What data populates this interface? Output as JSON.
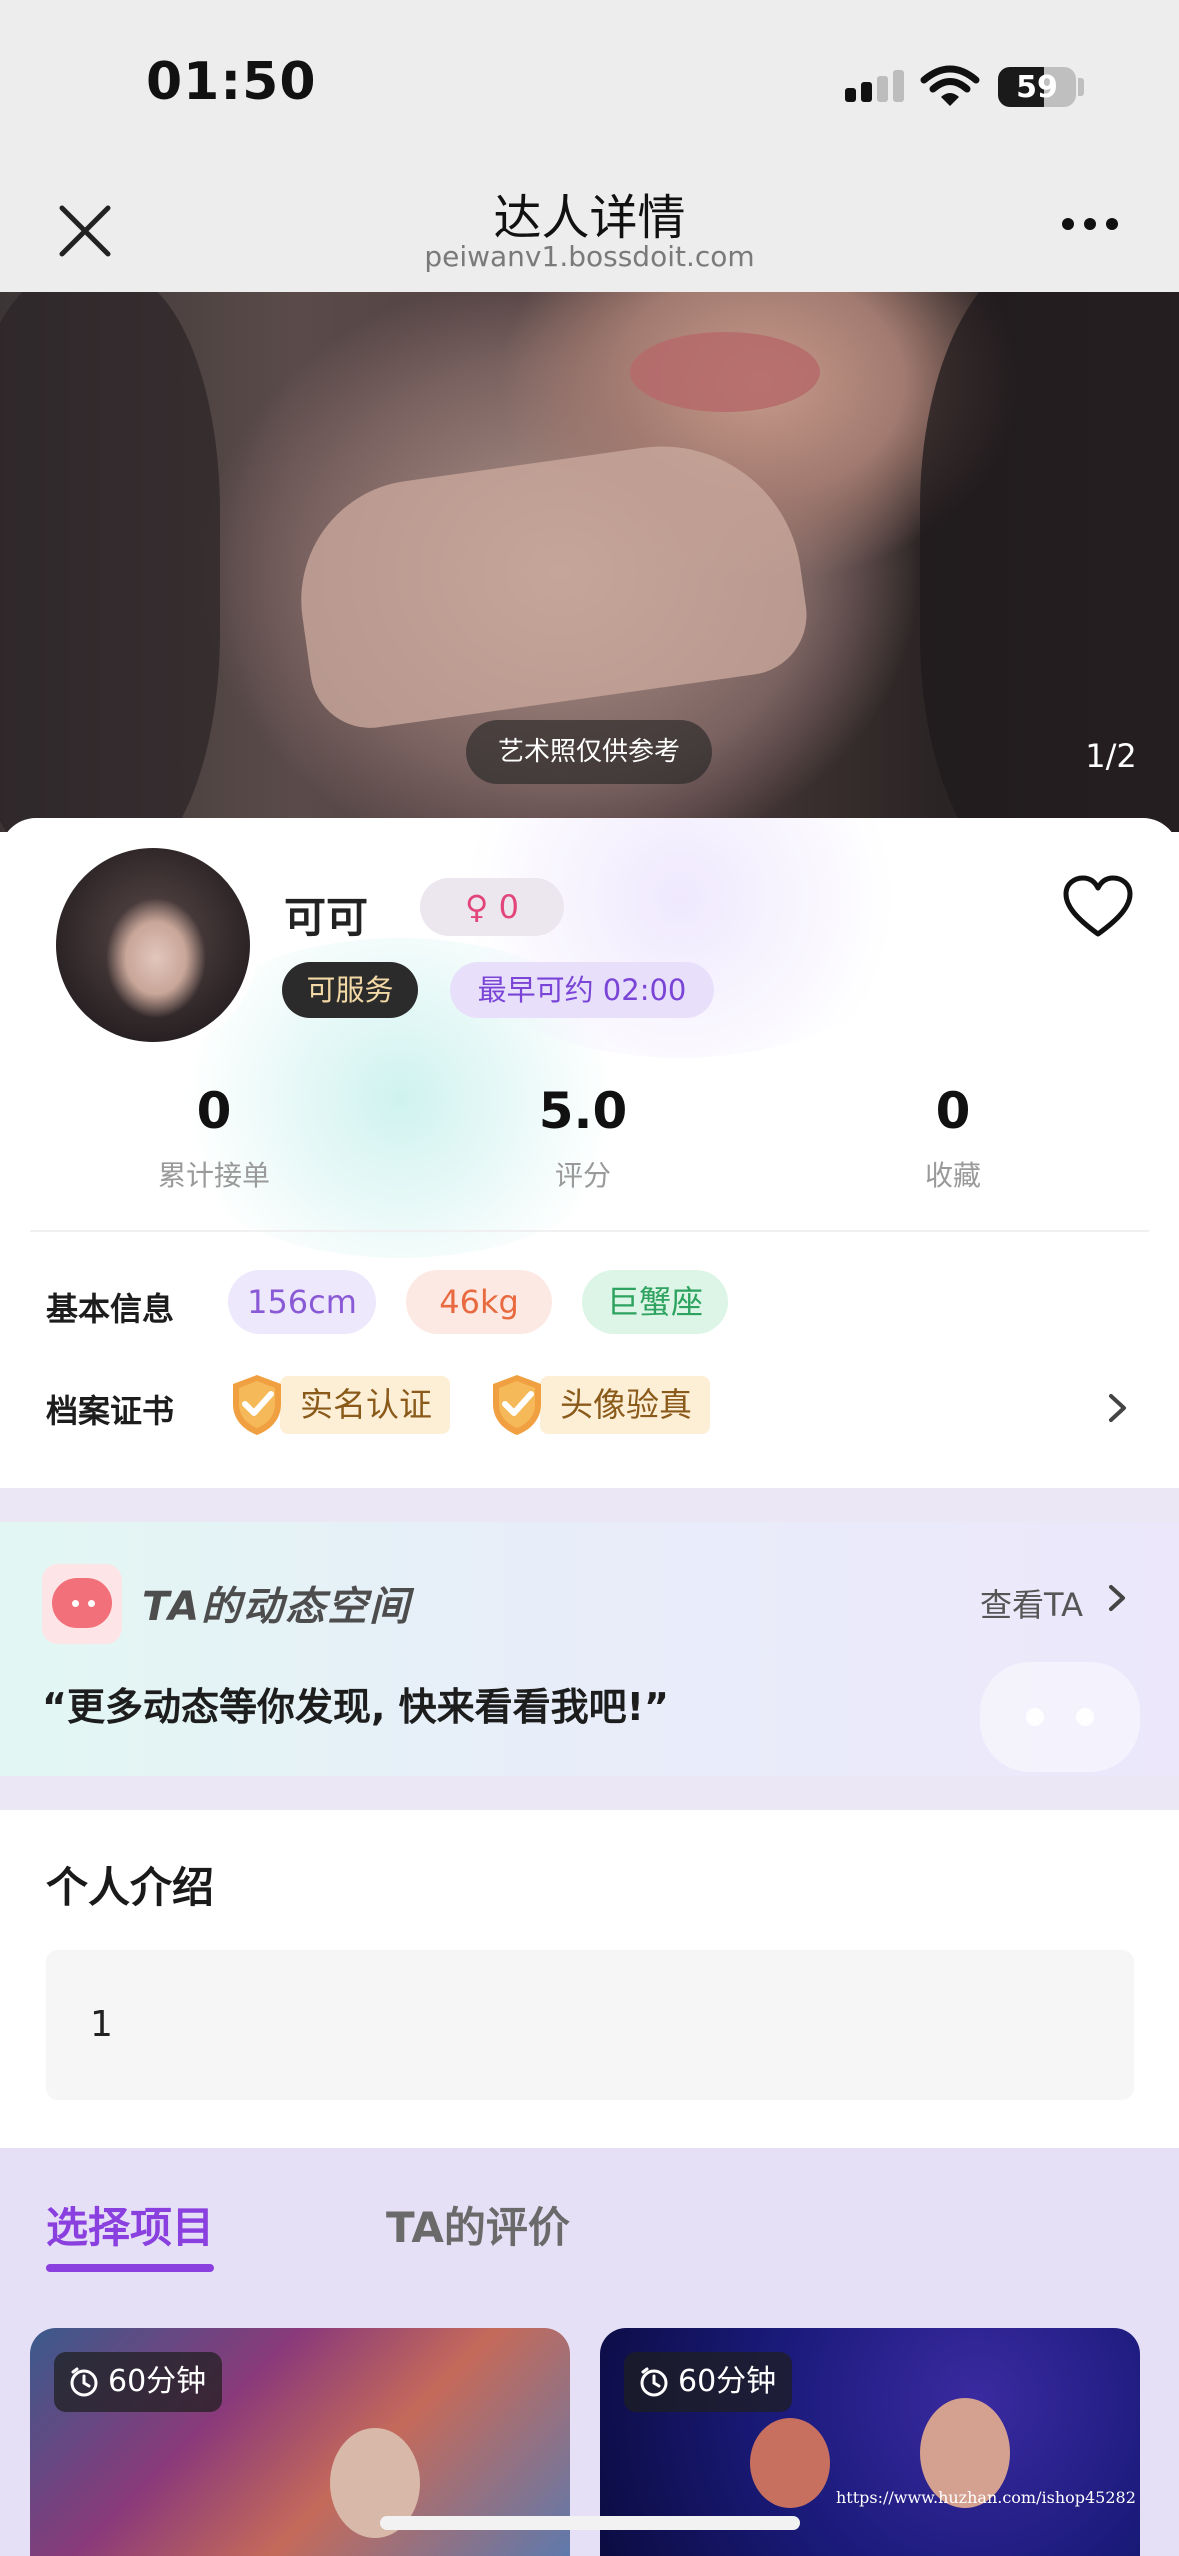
{
  "status_bar": {
    "time": "01:50",
    "battery": "59",
    "battery_fraction": 0.59
  },
  "header": {
    "title": "达人详情",
    "url": "peiwanv1.bossdoit.com"
  },
  "hero": {
    "art_notice": "艺术照仅供参考",
    "counter": "1/2"
  },
  "profile": {
    "name": "可可",
    "gender_symbol": "♀",
    "gender_count": "0",
    "status": "可服务",
    "earliest": "最早可约 02:00",
    "stats": [
      {
        "value": "0",
        "label": "累计接单"
      },
      {
        "value": "5.0",
        "label": "评分"
      },
      {
        "value": "0",
        "label": "收藏"
      }
    ]
  },
  "basic_info": {
    "label": "基本信息",
    "height": "156cm",
    "weight": "46kg",
    "zodiac": "巨蟹座"
  },
  "certificates": {
    "label": "档案证书",
    "items": [
      "实名认证",
      "头像验真"
    ]
  },
  "moments": {
    "title": "TA的动态空间",
    "link": "查看TA",
    "quote": "“更多动态等你发现, 快来看看我吧!”"
  },
  "intro": {
    "title": "个人介绍",
    "text": "1"
  },
  "tabs": {
    "active": "选择项目",
    "inactive": "TA的评价"
  },
  "services": [
    {
      "duration": "60分钟"
    },
    {
      "duration": "60分钟"
    }
  ],
  "watermark": "https://www.huzhan.com/ishop45282",
  "colors": {
    "accent": "#8a3fdf",
    "gender": "#e2457a",
    "badge_bg": "#fdeed6"
  }
}
